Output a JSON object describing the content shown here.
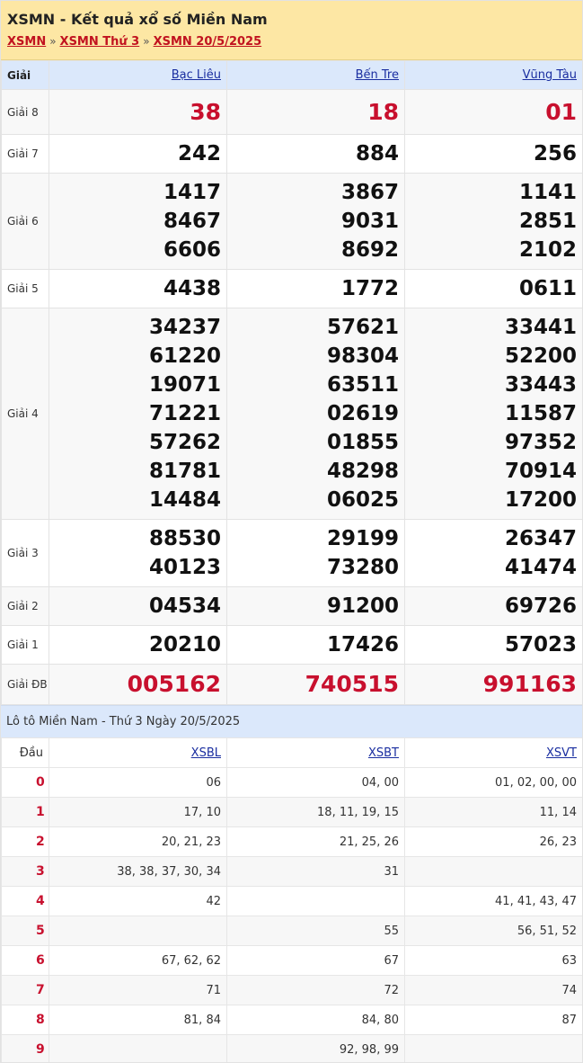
{
  "header": {
    "title": "XSMN - Kết quả xổ số Miền Nam",
    "breadcrumb": [
      "XSMN",
      "XSMN Thứ 3",
      "XSMN 20/5/2025"
    ],
    "separator": "»"
  },
  "results": {
    "label_header": "Giải",
    "provinces": [
      "Bạc Liêu",
      "Bến Tre",
      "Vũng Tàu"
    ],
    "prizes": [
      {
        "name": "Giải 8",
        "values": [
          [
            "38"
          ],
          [
            "18"
          ],
          [
            "01"
          ]
        ]
      },
      {
        "name": "Giải 7",
        "values": [
          [
            "242"
          ],
          [
            "884"
          ],
          [
            "256"
          ]
        ]
      },
      {
        "name": "Giải 6",
        "values": [
          [
            "1417",
            "8467",
            "6606"
          ],
          [
            "3867",
            "9031",
            "8692"
          ],
          [
            "1141",
            "2851",
            "2102"
          ]
        ]
      },
      {
        "name": "Giải 5",
        "values": [
          [
            "4438"
          ],
          [
            "1772"
          ],
          [
            "0611"
          ]
        ]
      },
      {
        "name": "Giải 4",
        "values": [
          [
            "34237",
            "61220",
            "19071",
            "71221",
            "57262",
            "81781",
            "14484"
          ],
          [
            "57621",
            "98304",
            "63511",
            "02619",
            "01855",
            "48298",
            "06025"
          ],
          [
            "33441",
            "52200",
            "33443",
            "11587",
            "97352",
            "70914",
            "17200"
          ]
        ]
      },
      {
        "name": "Giải 3",
        "values": [
          [
            "88530",
            "40123"
          ],
          [
            "29199",
            "73280"
          ],
          [
            "26347",
            "41474"
          ]
        ]
      },
      {
        "name": "Giải 2",
        "values": [
          [
            "04534"
          ],
          [
            "91200"
          ],
          [
            "69726"
          ]
        ]
      },
      {
        "name": "Giải 1",
        "values": [
          [
            "20210"
          ],
          [
            "17426"
          ],
          [
            "57023"
          ]
        ]
      },
      {
        "name": "Giải ĐB",
        "values": [
          [
            "005162"
          ],
          [
            "740515"
          ],
          [
            "991163"
          ]
        ]
      }
    ]
  },
  "loto": {
    "title": "Lô tô Miền Nam - Thứ 3 Ngày 20/5/2025",
    "head_label": "Đầu",
    "columns": [
      "XSBL",
      "XSBT",
      "XSVT"
    ],
    "rows": [
      {
        "dau": "0",
        "cells": [
          "06",
          "04, 00",
          "01, 02, 00, 00"
        ]
      },
      {
        "dau": "1",
        "cells": [
          "17, 10",
          "18, 11, 19, 15",
          "11, 14"
        ]
      },
      {
        "dau": "2",
        "cells": [
          "20, 21, 23",
          "21, 25, 26",
          "26, 23"
        ]
      },
      {
        "dau": "3",
        "cells": [
          "38, 38, 37, 30, 34",
          "31",
          ""
        ]
      },
      {
        "dau": "4",
        "cells": [
          "42",
          "",
          "41, 41, 43, 47"
        ]
      },
      {
        "dau": "5",
        "cells": [
          "",
          "55",
          "56, 51, 52"
        ]
      },
      {
        "dau": "6",
        "cells": [
          "67, 62, 62",
          "67",
          "63"
        ]
      },
      {
        "dau": "7",
        "cells": [
          "71",
          "72",
          "74"
        ]
      },
      {
        "dau": "8",
        "cells": [
          "81, 84",
          "84, 80",
          "87"
        ]
      },
      {
        "dau": "9",
        "cells": [
          "",
          "92, 98, 99",
          ""
        ]
      }
    ]
  },
  "colors": {
    "accent_red": "#c8102e",
    "link_blue": "#1a2ea0",
    "header_bg": "#fde7a4",
    "table_head_bg": "#dbe8fb"
  }
}
